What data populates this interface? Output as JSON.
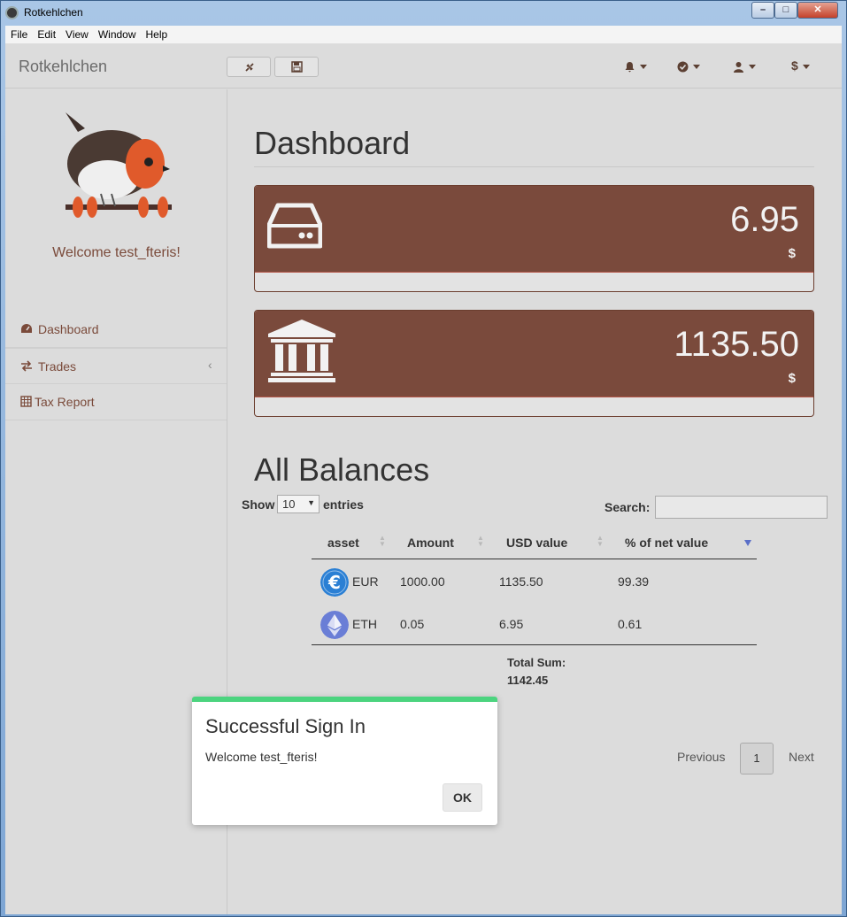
{
  "window": {
    "title": "Rotkehlchen"
  },
  "menu": [
    "File",
    "Edit",
    "View",
    "Window",
    "Help"
  ],
  "navbar": {
    "brand": "Rotkehlchen",
    "right_icons": [
      "bell-icon",
      "check-circle-icon",
      "user-icon",
      "dollar-icon"
    ],
    "currency_symbol": "$"
  },
  "sidebar": {
    "welcome": "Welcome test_fteris!",
    "items": [
      {
        "label": "Dashboard",
        "icon": "dashboard-icon"
      },
      {
        "label": "Trades",
        "icon": "exchange-icon"
      },
      {
        "label": "Tax Report",
        "icon": "table-icon"
      }
    ]
  },
  "dashboard": {
    "title": "Dashboard",
    "panels": [
      {
        "value": "6.95",
        "currency": "$",
        "icon": "hard-drive-icon"
      },
      {
        "value": "1135.50",
        "currency": "$",
        "icon": "bank-icon"
      }
    ]
  },
  "balances": {
    "title": "All Balances",
    "show_label": "Show",
    "show_value": "10",
    "entries_label": "entries",
    "search_label": "Search:",
    "search_value": "",
    "columns": [
      "asset",
      "Amount",
      "USD value",
      "% of net value"
    ],
    "rows": [
      {
        "asset": "EUR",
        "amount": "1000.00",
        "usd": "1135.50",
        "pct": "99.39",
        "icon": "euro-coin-icon",
        "color": "#2a7fd4"
      },
      {
        "asset": "ETH",
        "amount": "0.05",
        "usd": "6.95",
        "pct": "0.61",
        "icon": "ethereum-coin-icon",
        "color": "#6a7ed6"
      }
    ],
    "total_label": "Total Sum:",
    "total_value": "1142.45",
    "pagination": {
      "previous": "Previous",
      "page": "1",
      "next": "Next"
    }
  },
  "modal": {
    "title": "Successful Sign In",
    "text": "Welcome test_fteris!",
    "ok": "OK",
    "accent": "#4cd47f"
  },
  "colors": {
    "panel": "#7a4a3c",
    "accent_text": "#7a4a3a"
  }
}
